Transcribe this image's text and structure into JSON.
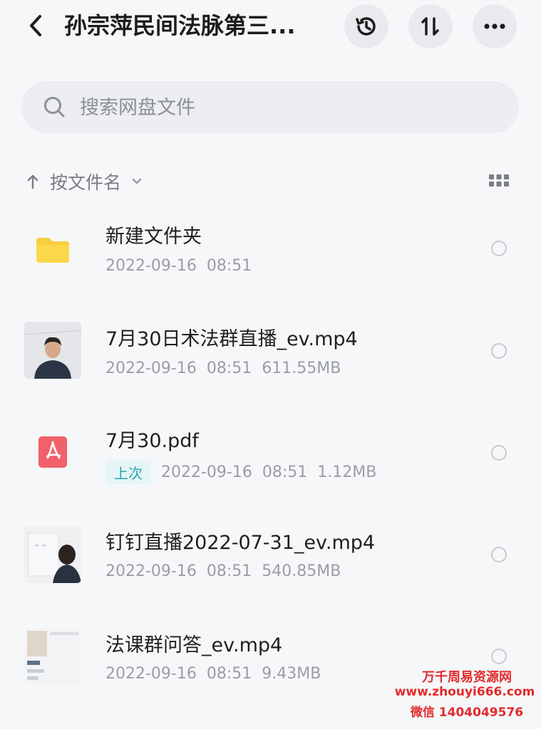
{
  "header": {
    "title": "孙宗萍民间法脉第三..."
  },
  "search": {
    "placeholder": "搜索网盘文件"
  },
  "sort": {
    "label": "按文件名"
  },
  "files": [
    {
      "name": "新建文件夹",
      "date": "2022-09-16",
      "time": "08:51",
      "size": "",
      "type": "folder"
    },
    {
      "name": "7月30日术法群直播_ev.mp4",
      "date": "2022-09-16",
      "time": "08:51",
      "size": "611.55MB",
      "type": "video"
    },
    {
      "name": "7月30.pdf",
      "date": "2022-09-16",
      "time": "08:51",
      "size": "1.12MB",
      "type": "pdf",
      "tag": "上次"
    },
    {
      "name": "钉钉直播2022-07-31_ev.mp4",
      "date": "2022-09-16",
      "time": "08:51",
      "size": "540.85MB",
      "type": "video"
    },
    {
      "name": "法课群问答_ev.mp4",
      "date": "2022-09-16",
      "time": "08:51",
      "size": "9.43MB",
      "type": "video"
    }
  ],
  "watermark": {
    "line1": "万千周易资源网",
    "line2": "www.zhouyi666.com",
    "line3": "微信 1404049576"
  },
  "colors": {
    "folder": "#f7cf3d",
    "pdf": "#f0616a",
    "tag_bg": "#e6f5f6",
    "tag_text": "#2ba6b0",
    "watermark": "#e32a2a"
  }
}
